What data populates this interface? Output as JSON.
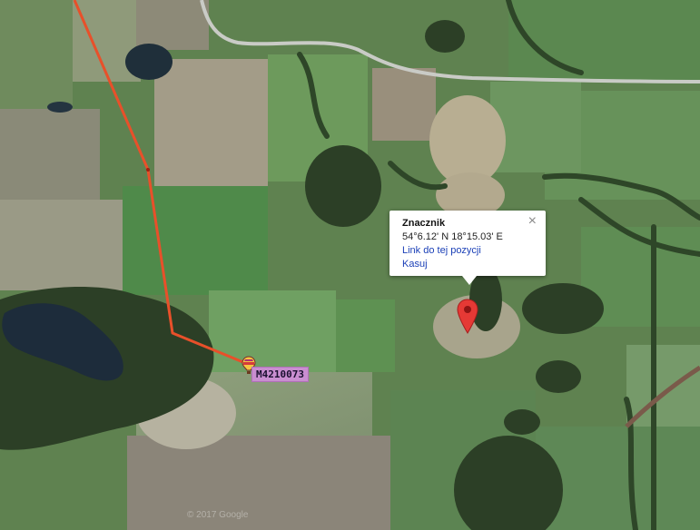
{
  "map": {
    "type": "satellite",
    "copyright": "© 2017 Google"
  },
  "popup": {
    "title": "Znacznik",
    "coordinates": "54°6.12' N 18°15.03' E",
    "link_label": "Link do tej pozycji",
    "delete_label": "Kasuj",
    "close_glyph": "×"
  },
  "balloon": {
    "callsign": "M4210073",
    "icon": "hot-air-balloon-icon"
  },
  "marker": {
    "icon": "map-pin-icon",
    "color": "#e53935"
  },
  "track": {
    "color": "#e8502a"
  }
}
